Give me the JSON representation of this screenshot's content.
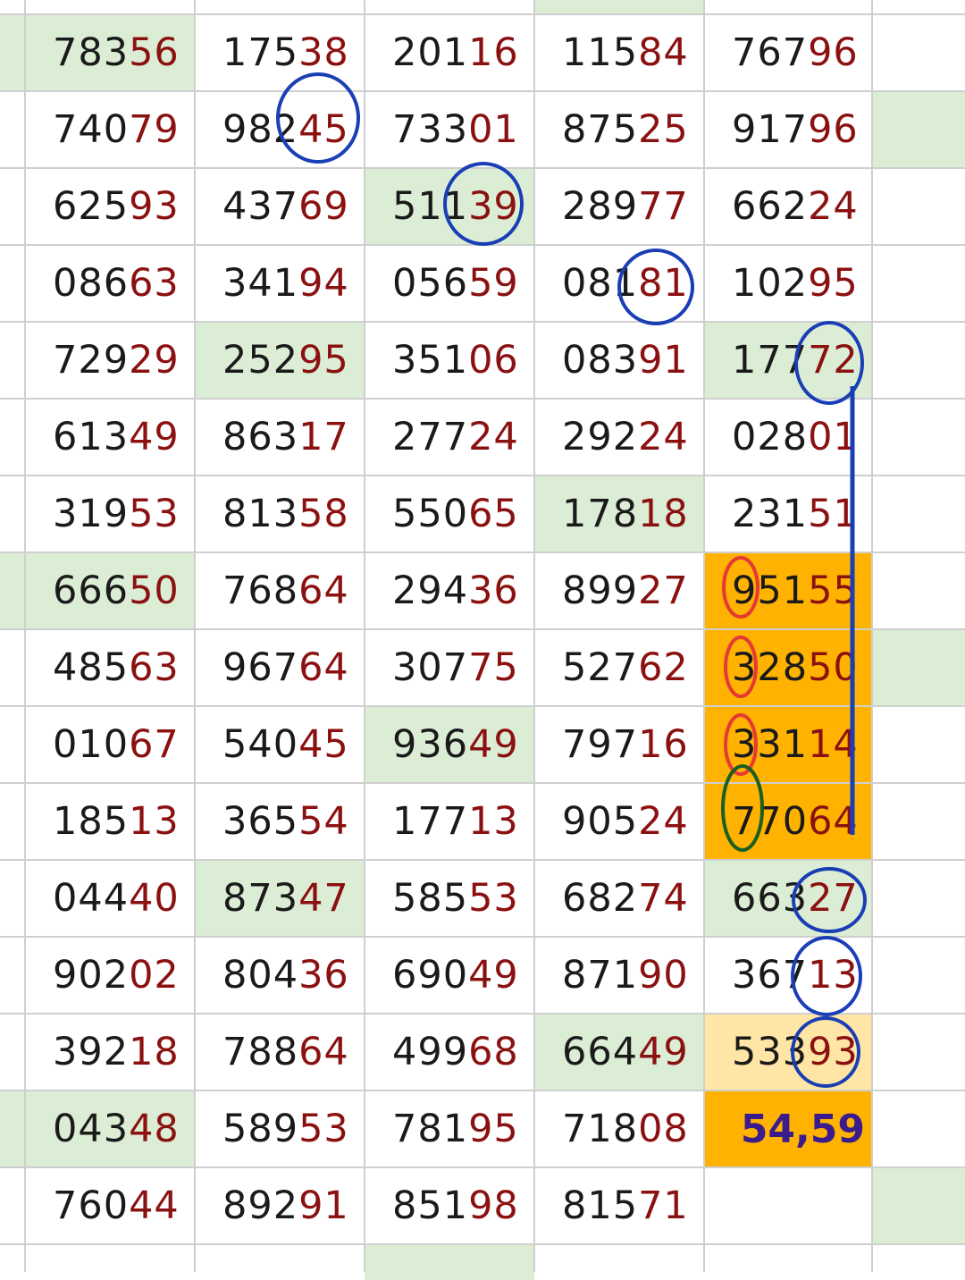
{
  "sheet": {
    "rows": [
      [
        {
          "pre": "783",
          "suf": "56",
          "hl": "green"
        },
        {
          "pre": "175",
          "suf": "38"
        },
        {
          "pre": "201",
          "suf": "16"
        },
        {
          "pre": "115",
          "suf": "84"
        },
        {
          "pre": "767",
          "suf": "96"
        }
      ],
      [
        {
          "pre": "740",
          "suf": "79"
        },
        {
          "pre": "982",
          "suf": "45"
        },
        {
          "pre": "733",
          "suf": "01"
        },
        {
          "pre": "875",
          "suf": "25"
        },
        {
          "pre": "917",
          "suf": "96"
        }
      ],
      [
        {
          "pre": "625",
          "suf": "93"
        },
        {
          "pre": "437",
          "suf": "69"
        },
        {
          "pre": "511",
          "suf": "39",
          "hl": "green"
        },
        {
          "pre": "289",
          "suf": "77"
        },
        {
          "pre": "662",
          "suf": "24"
        }
      ],
      [
        {
          "pre": "086",
          "suf": "63"
        },
        {
          "pre": "341",
          "suf": "94"
        },
        {
          "pre": "056",
          "suf": "59"
        },
        {
          "pre": "081",
          "suf": "81"
        },
        {
          "pre": "102",
          "suf": "95"
        }
      ],
      [
        {
          "pre": "729",
          "suf": "29"
        },
        {
          "pre": "252",
          "suf": "95",
          "hl": "green"
        },
        {
          "pre": "351",
          "suf": "06"
        },
        {
          "pre": "083",
          "suf": "91"
        },
        {
          "pre": "177",
          "suf": "72",
          "hl": "green"
        }
      ],
      [
        {
          "pre": "613",
          "suf": "49"
        },
        {
          "pre": "863",
          "suf": "17"
        },
        {
          "pre": "277",
          "suf": "24"
        },
        {
          "pre": "292",
          "suf": "24"
        },
        {
          "pre": "028",
          "suf": "01"
        }
      ],
      [
        {
          "pre": "319",
          "suf": "53"
        },
        {
          "pre": "813",
          "suf": "58"
        },
        {
          "pre": "550",
          "suf": "65"
        },
        {
          "pre": "178",
          "suf": "18",
          "hl": "green"
        },
        {
          "pre": "231",
          "suf": "51"
        }
      ],
      [
        {
          "pre": "666",
          "suf": "50",
          "hl": "green"
        },
        {
          "pre": "768",
          "suf": "64"
        },
        {
          "pre": "294",
          "suf": "36"
        },
        {
          "pre": "899",
          "suf": "27"
        },
        {
          "pre": "951",
          "suf": "55",
          "hl": "orange"
        }
      ],
      [
        {
          "pre": "485",
          "suf": "63"
        },
        {
          "pre": "967",
          "suf": "64"
        },
        {
          "pre": "307",
          "suf": "75"
        },
        {
          "pre": "527",
          "suf": "62"
        },
        {
          "pre": "328",
          "suf": "50",
          "hl": "orange"
        }
      ],
      [
        {
          "pre": "010",
          "suf": "67"
        },
        {
          "pre": "540",
          "suf": "45"
        },
        {
          "pre": "936",
          "suf": "49",
          "hl": "green"
        },
        {
          "pre": "797",
          "suf": "16"
        },
        {
          "pre": "331",
          "suf": "14",
          "hl": "orange"
        }
      ],
      [
        {
          "pre": "185",
          "suf": "13"
        },
        {
          "pre": "365",
          "suf": "54"
        },
        {
          "pre": "177",
          "suf": "13"
        },
        {
          "pre": "905",
          "suf": "24"
        },
        {
          "pre": "770",
          "suf": "64",
          "hl": "orange"
        }
      ],
      [
        {
          "pre": "044",
          "suf": "40"
        },
        {
          "pre": "873",
          "suf": "47",
          "hl": "green"
        },
        {
          "pre": "585",
          "suf": "53"
        },
        {
          "pre": "682",
          "suf": "74"
        },
        {
          "pre": "663",
          "suf": "27",
          "hl": "green"
        }
      ],
      [
        {
          "pre": "902",
          "suf": "02"
        },
        {
          "pre": "804",
          "suf": "36"
        },
        {
          "pre": "690",
          "suf": "49"
        },
        {
          "pre": "871",
          "suf": "90"
        },
        {
          "pre": "367",
          "suf": "13"
        }
      ],
      [
        {
          "pre": "392",
          "suf": "18"
        },
        {
          "pre": "788",
          "suf": "64"
        },
        {
          "pre": "499",
          "suf": "68"
        },
        {
          "pre": "664",
          "suf": "49",
          "hl": "green"
        },
        {
          "pre": "533",
          "suf": "93",
          "hl": "lightorange"
        }
      ],
      [
        {
          "pre": "043",
          "suf": "48",
          "hl": "green"
        },
        {
          "pre": "589",
          "suf": "53"
        },
        {
          "pre": "781",
          "suf": "95"
        },
        {
          "pre": "718",
          "suf": "08"
        },
        {
          "sum": "54,59",
          "hl": "orange"
        }
      ],
      [
        {
          "pre": "760",
          "suf": "44"
        },
        {
          "pre": "892",
          "suf": "91"
        },
        {
          "pre": "851",
          "suf": "98"
        },
        {
          "pre": "815",
          "suf": "71"
        },
        {
          "pre": "",
          "suf": ""
        }
      ]
    ]
  },
  "colors": {
    "grid_line": "#cfcfcf",
    "highlight_green": "#dcedd6",
    "highlight_orange": "#ffb300",
    "highlight_light_orange": "#ffe6a6",
    "suffix_digits": "#8b1111",
    "annotation_blue": "#1a3fb5",
    "annotation_red": "#e53935",
    "annotation_green": "#1b5e20",
    "sum_text": "#3b1c8c"
  }
}
